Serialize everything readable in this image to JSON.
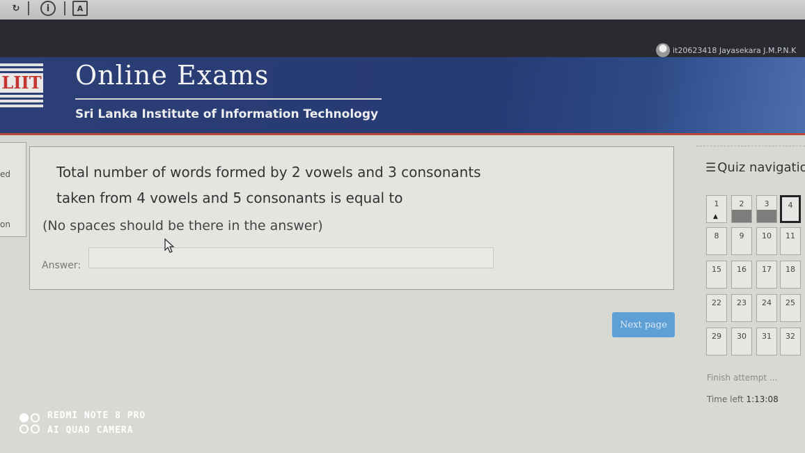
{
  "user": {
    "name": "it20623418 Jayasekara J.M.P.N.K"
  },
  "header": {
    "logo_text": "LIIT",
    "title": "Online Exams",
    "subtitle": "Sri Lanka Institute of Information Technology"
  },
  "left_nav": {
    "item_1": "ed",
    "item_2": "on"
  },
  "question": {
    "line_1": "Total number of words formed by 2 vowels and 3 consonants",
    "line_2": "taken from 4 vowels and 5 consonants is equal to",
    "note": "(No spaces should be there in the answer)",
    "answer_label": "Answer:",
    "answer_value": ""
  },
  "next_button": "Next page",
  "quiz_nav": {
    "title": "Quiz navigatior",
    "buttons": [
      {
        "label": "1",
        "answered": false,
        "flagged": true,
        "current": false
      },
      {
        "label": "2",
        "answered": true,
        "flagged": false,
        "current": false
      },
      {
        "label": "3",
        "answered": true,
        "flagged": false,
        "current": false
      },
      {
        "label": "4",
        "answered": false,
        "flagged": false,
        "current": true
      },
      {
        "label": "8"
      },
      {
        "label": "9"
      },
      {
        "label": "10"
      },
      {
        "label": "11"
      },
      {
        "label": "15"
      },
      {
        "label": "16"
      },
      {
        "label": "17"
      },
      {
        "label": "18"
      },
      {
        "label": "22"
      },
      {
        "label": "23"
      },
      {
        "label": "24"
      },
      {
        "label": "25"
      },
      {
        "label": "29"
      },
      {
        "label": "30"
      },
      {
        "label": "31"
      },
      {
        "label": "32"
      }
    ],
    "finish_link": "Finish attempt ...",
    "time_left_label": "Time left",
    "time_left_value": "1:13:08"
  },
  "watermark": {
    "line_1": "REDMI NOTE 8 PRO",
    "line_2": "AI QUAD CAMERA"
  }
}
